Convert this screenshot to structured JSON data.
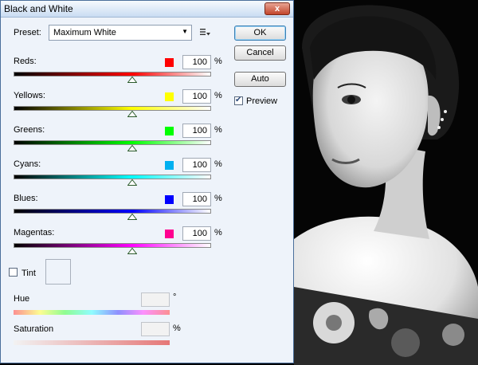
{
  "window": {
    "title": "Black and White",
    "close_label": "x"
  },
  "preset": {
    "label": "Preset:",
    "value": "Maximum White"
  },
  "buttons": {
    "ok": "OK",
    "cancel": "Cancel",
    "auto": "Auto"
  },
  "preview": {
    "label": "Preview",
    "checked": true
  },
  "colors": [
    {
      "name": "Reds:",
      "value": "100",
      "unit": "%",
      "swatch": "#ff0000",
      "slider_fraction": 0.6
    },
    {
      "name": "Yellows:",
      "value": "100",
      "unit": "%",
      "swatch": "#ffff00",
      "slider_fraction": 0.6
    },
    {
      "name": "Greens:",
      "value": "100",
      "unit": "%",
      "swatch": "#00ff00",
      "slider_fraction": 0.6
    },
    {
      "name": "Cyans:",
      "value": "100",
      "unit": "%",
      "swatch": "#00b0f0",
      "slider_fraction": 0.6
    },
    {
      "name": "Blues:",
      "value": "100",
      "unit": "%",
      "swatch": "#0000ff",
      "slider_fraction": 0.6
    },
    {
      "name": "Magentas:",
      "value": "100",
      "unit": "%",
      "swatch": "#ff0090",
      "slider_fraction": 0.6
    }
  ],
  "tint": {
    "label": "Tint",
    "checked": false
  },
  "hue": {
    "label": "Hue",
    "unit": "°"
  },
  "saturation": {
    "label": "Saturation",
    "unit": "%"
  }
}
